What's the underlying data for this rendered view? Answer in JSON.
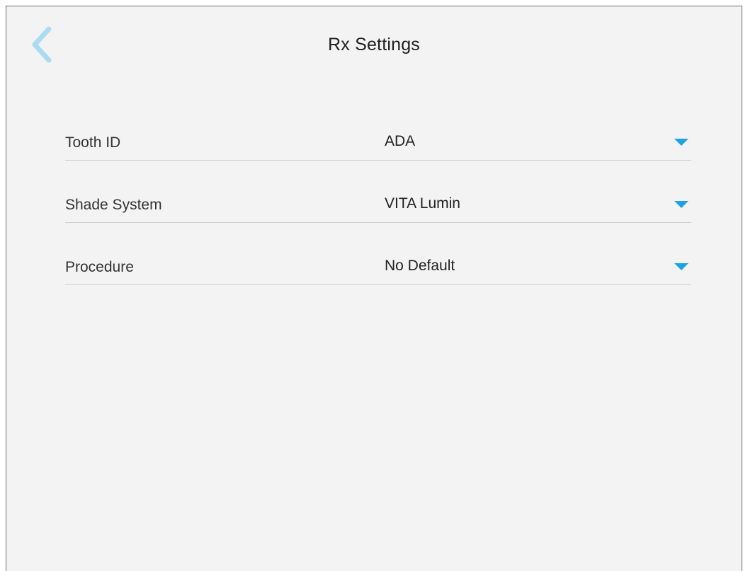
{
  "header": {
    "title": "Rx Settings",
    "back_icon": "chevron-left-icon"
  },
  "colors": {
    "accent": "#1aa3e8",
    "back_icon": "#a9dcf2",
    "background": "#f3f3f3",
    "divider": "#cfcfcf"
  },
  "settings": [
    {
      "label": "Tooth ID",
      "value": "ADA",
      "icon": "caret-down-icon"
    },
    {
      "label": "Shade System",
      "value": "VITA Lumin",
      "icon": "caret-down-icon"
    },
    {
      "label": "Procedure",
      "value": "No Default",
      "icon": "caret-down-icon"
    }
  ]
}
